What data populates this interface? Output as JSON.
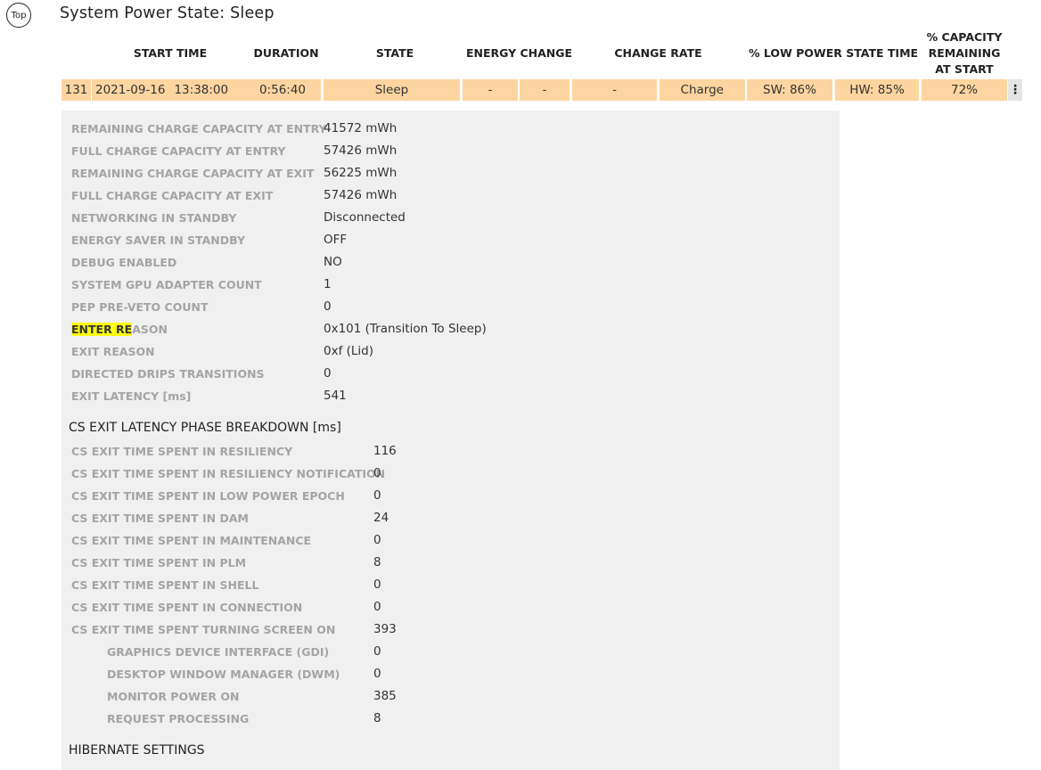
{
  "top_button": "Top",
  "title": "System Power State: Sleep",
  "columns": {
    "start_time": "START TIME",
    "duration": "DURATION",
    "state": "STATE",
    "energy_change": "ENERGY CHANGE",
    "change_rate": "CHANGE RATE",
    "low_power": "% LOW POWER STATE TIME",
    "capacity_l1": "% CAPACITY",
    "capacity_l2": "REMAINING",
    "capacity_l3": "AT START"
  },
  "row": {
    "index": "131",
    "date": "2021-09-16",
    "time": "13:38:00",
    "duration": "0:56:40",
    "state": "Sleep",
    "energy_change_1": "-",
    "energy_change_2": "-",
    "change_rate": "-",
    "rate_type": "Charge",
    "sw": "SW: 86%",
    "hw": "HW: 85%",
    "capacity": "72%",
    "menu": "⋮"
  },
  "details": [
    {
      "label": "REMAINING CHARGE CAPACITY AT ENTRY",
      "value": "41572 mWh"
    },
    {
      "label": "FULL CHARGE CAPACITY AT ENTRY",
      "value": "57426 mWh"
    },
    {
      "label": "REMAINING CHARGE CAPACITY AT EXIT",
      "value": "56225 mWh"
    },
    {
      "label": "FULL CHARGE CAPACITY AT EXIT",
      "value": "57426 mWh"
    },
    {
      "label": "NETWORKING IN STANDBY",
      "value": "Disconnected"
    },
    {
      "label": "ENERGY SAVER IN STANDBY",
      "value": "OFF"
    },
    {
      "label": "DEBUG ENABLED",
      "value": "NO"
    },
    {
      "label": "SYSTEM GPU ADAPTER COUNT",
      "value": "1"
    },
    {
      "label": "PEP PRE-VETO COUNT",
      "value": "0"
    },
    {
      "label_highlight": "ENTER RE",
      "label_rest": "ASON",
      "value": "0x101 (Transition To Sleep)"
    },
    {
      "label": "EXIT REASON",
      "value": "0xf (Lid)"
    },
    {
      "label": "DIRECTED DRIPS TRANSITIONS",
      "value": "0"
    },
    {
      "label": "EXIT LATENCY [ms]",
      "value": "541"
    }
  ],
  "cs_section_title": "CS EXIT LATENCY PHASE BREAKDOWN [ms]",
  "cs_details": [
    {
      "label": "CS EXIT TIME SPENT IN RESILIENCY",
      "value": "116"
    },
    {
      "label": "CS EXIT TIME SPENT IN RESILIENCY NOTIFICATION",
      "value": "0"
    },
    {
      "label": "CS EXIT TIME SPENT IN LOW POWER EPOCH",
      "value": "0"
    },
    {
      "label": "CS EXIT TIME SPENT IN DAM",
      "value": "24"
    },
    {
      "label": "CS EXIT TIME SPENT IN MAINTENANCE",
      "value": "0"
    },
    {
      "label": "CS EXIT TIME SPENT IN PLM",
      "value": "8"
    },
    {
      "label": "CS EXIT TIME SPENT IN SHELL",
      "value": "0"
    },
    {
      "label": "CS EXIT TIME SPENT IN CONNECTION",
      "value": "0"
    },
    {
      "label": "CS EXIT TIME SPENT TURNING SCREEN ON",
      "value": "393"
    },
    {
      "label": "GRAPHICS DEVICE INTERFACE (GDI)",
      "value": "0"
    },
    {
      "label": "DESKTOP WINDOW MANAGER (DWM)",
      "value": "0"
    },
    {
      "label": "MONITOR POWER ON",
      "value": "385"
    },
    {
      "label": "REQUEST PROCESSING",
      "value": "8"
    }
  ],
  "hibernate_title": "HIBERNATE SETTINGS"
}
